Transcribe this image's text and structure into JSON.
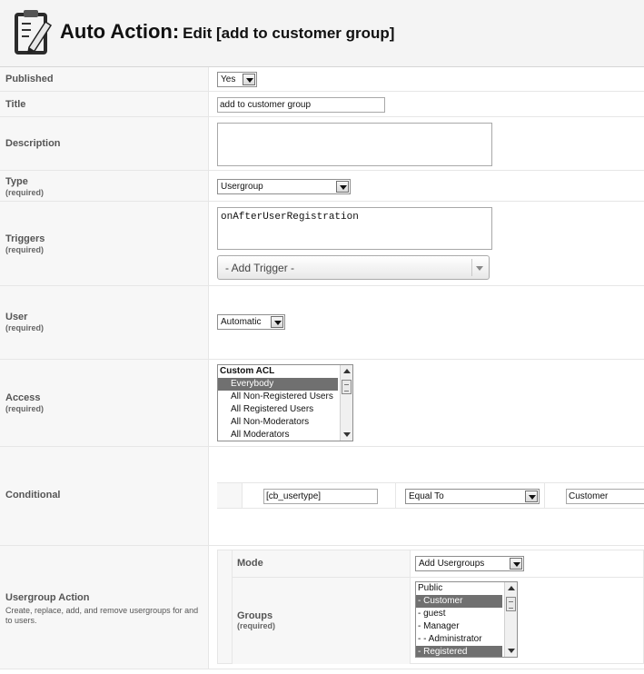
{
  "header": {
    "title": "Auto Action:",
    "subtitle": "Edit [add to customer group]",
    "logo_icon": "clipboard-pencil-icon"
  },
  "published": {
    "label": "Published",
    "value": "Yes"
  },
  "title_field": {
    "label": "Title",
    "value": "add to customer group"
  },
  "description": {
    "label": "Description",
    "value": ""
  },
  "type": {
    "label": "Type",
    "required": "(required)",
    "value": "Usergroup"
  },
  "triggers": {
    "label": "Triggers",
    "required": "(required)",
    "value": "onAfterUserRegistration",
    "add_placeholder": "- Add Trigger -"
  },
  "user": {
    "label": "User",
    "required": "(required)",
    "value": "Automatic"
  },
  "access": {
    "label": "Access",
    "required": "(required)",
    "group_label": "Custom ACL",
    "options": [
      "Everybody",
      "All Non-Registered Users",
      "All Registered Users",
      "All Non-Moderators",
      "All Moderators"
    ],
    "selected": "Everybody"
  },
  "conditional": {
    "label": "Conditional",
    "field": "[cb_usertype]",
    "operator": "Equal To",
    "value": "Customer"
  },
  "usergroup_action": {
    "label": "Usergroup Action",
    "description": "Create, replace, add, and remove usergroups for and to users.",
    "mode_label": "Mode",
    "mode_value": "Add Usergroups",
    "groups_label": "Groups",
    "groups_required": "(required)",
    "groups_options": [
      "Public",
      "- Customer",
      "- guest",
      "- Manager",
      "- - Administrator",
      "- Registered"
    ],
    "groups_selected": [
      "- Customer",
      "- Registered"
    ]
  },
  "colors": {
    "label_bg": "#f7f7f7",
    "selected_bg": "#707070",
    "border": "#e6e6e6"
  }
}
